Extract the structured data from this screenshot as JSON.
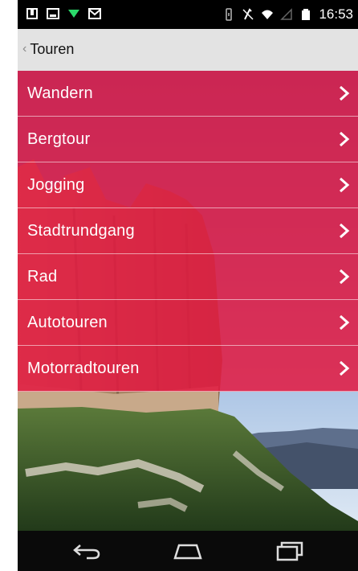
{
  "status_bar": {
    "time": "16:53",
    "left_icons": [
      "download-icon",
      "image-icon",
      "wifi-down-icon",
      "gmail-icon"
    ],
    "right_icons": [
      "vibrate-icon",
      "no-sim-icon",
      "wifi-icon",
      "signal-icon",
      "battery-icon"
    ]
  },
  "action_bar": {
    "back_label": "Touren",
    "back_glyph": "‹"
  },
  "menu": {
    "items": [
      {
        "label": "Wandern"
      },
      {
        "label": "Bergtour"
      },
      {
        "label": "Jogging"
      },
      {
        "label": "Stadtrundgang"
      },
      {
        "label": "Rad"
      },
      {
        "label": "Autotouren"
      },
      {
        "label": "Motorradtouren"
      }
    ],
    "row_color": "#e21840"
  },
  "nav_bar": {
    "buttons": [
      "back-icon",
      "home-icon",
      "recent-apps-icon"
    ]
  }
}
